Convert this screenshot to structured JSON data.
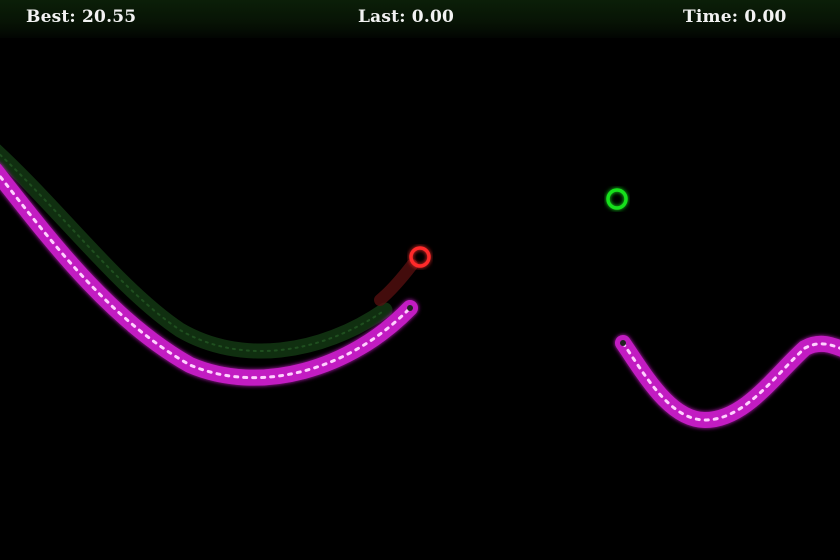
{
  "hud": {
    "best_label": "Best:",
    "best_value": "20.55",
    "last_label": "Last:",
    "last_value": "0.00",
    "time_label": "Time:",
    "time_value": "0.00"
  },
  "colors": {
    "background": "#000000",
    "hud_bar": "#0b1f08",
    "hud_text": "#f2f2f2",
    "player_snake": "#d633d6",
    "ghost_snake": "#1f5a1f",
    "target_ring": "#19e01e",
    "cursor_ring": "#ff2a2a"
  },
  "icons": {
    "target": "green-ring-icon",
    "cursor": "red-ring-icon"
  }
}
